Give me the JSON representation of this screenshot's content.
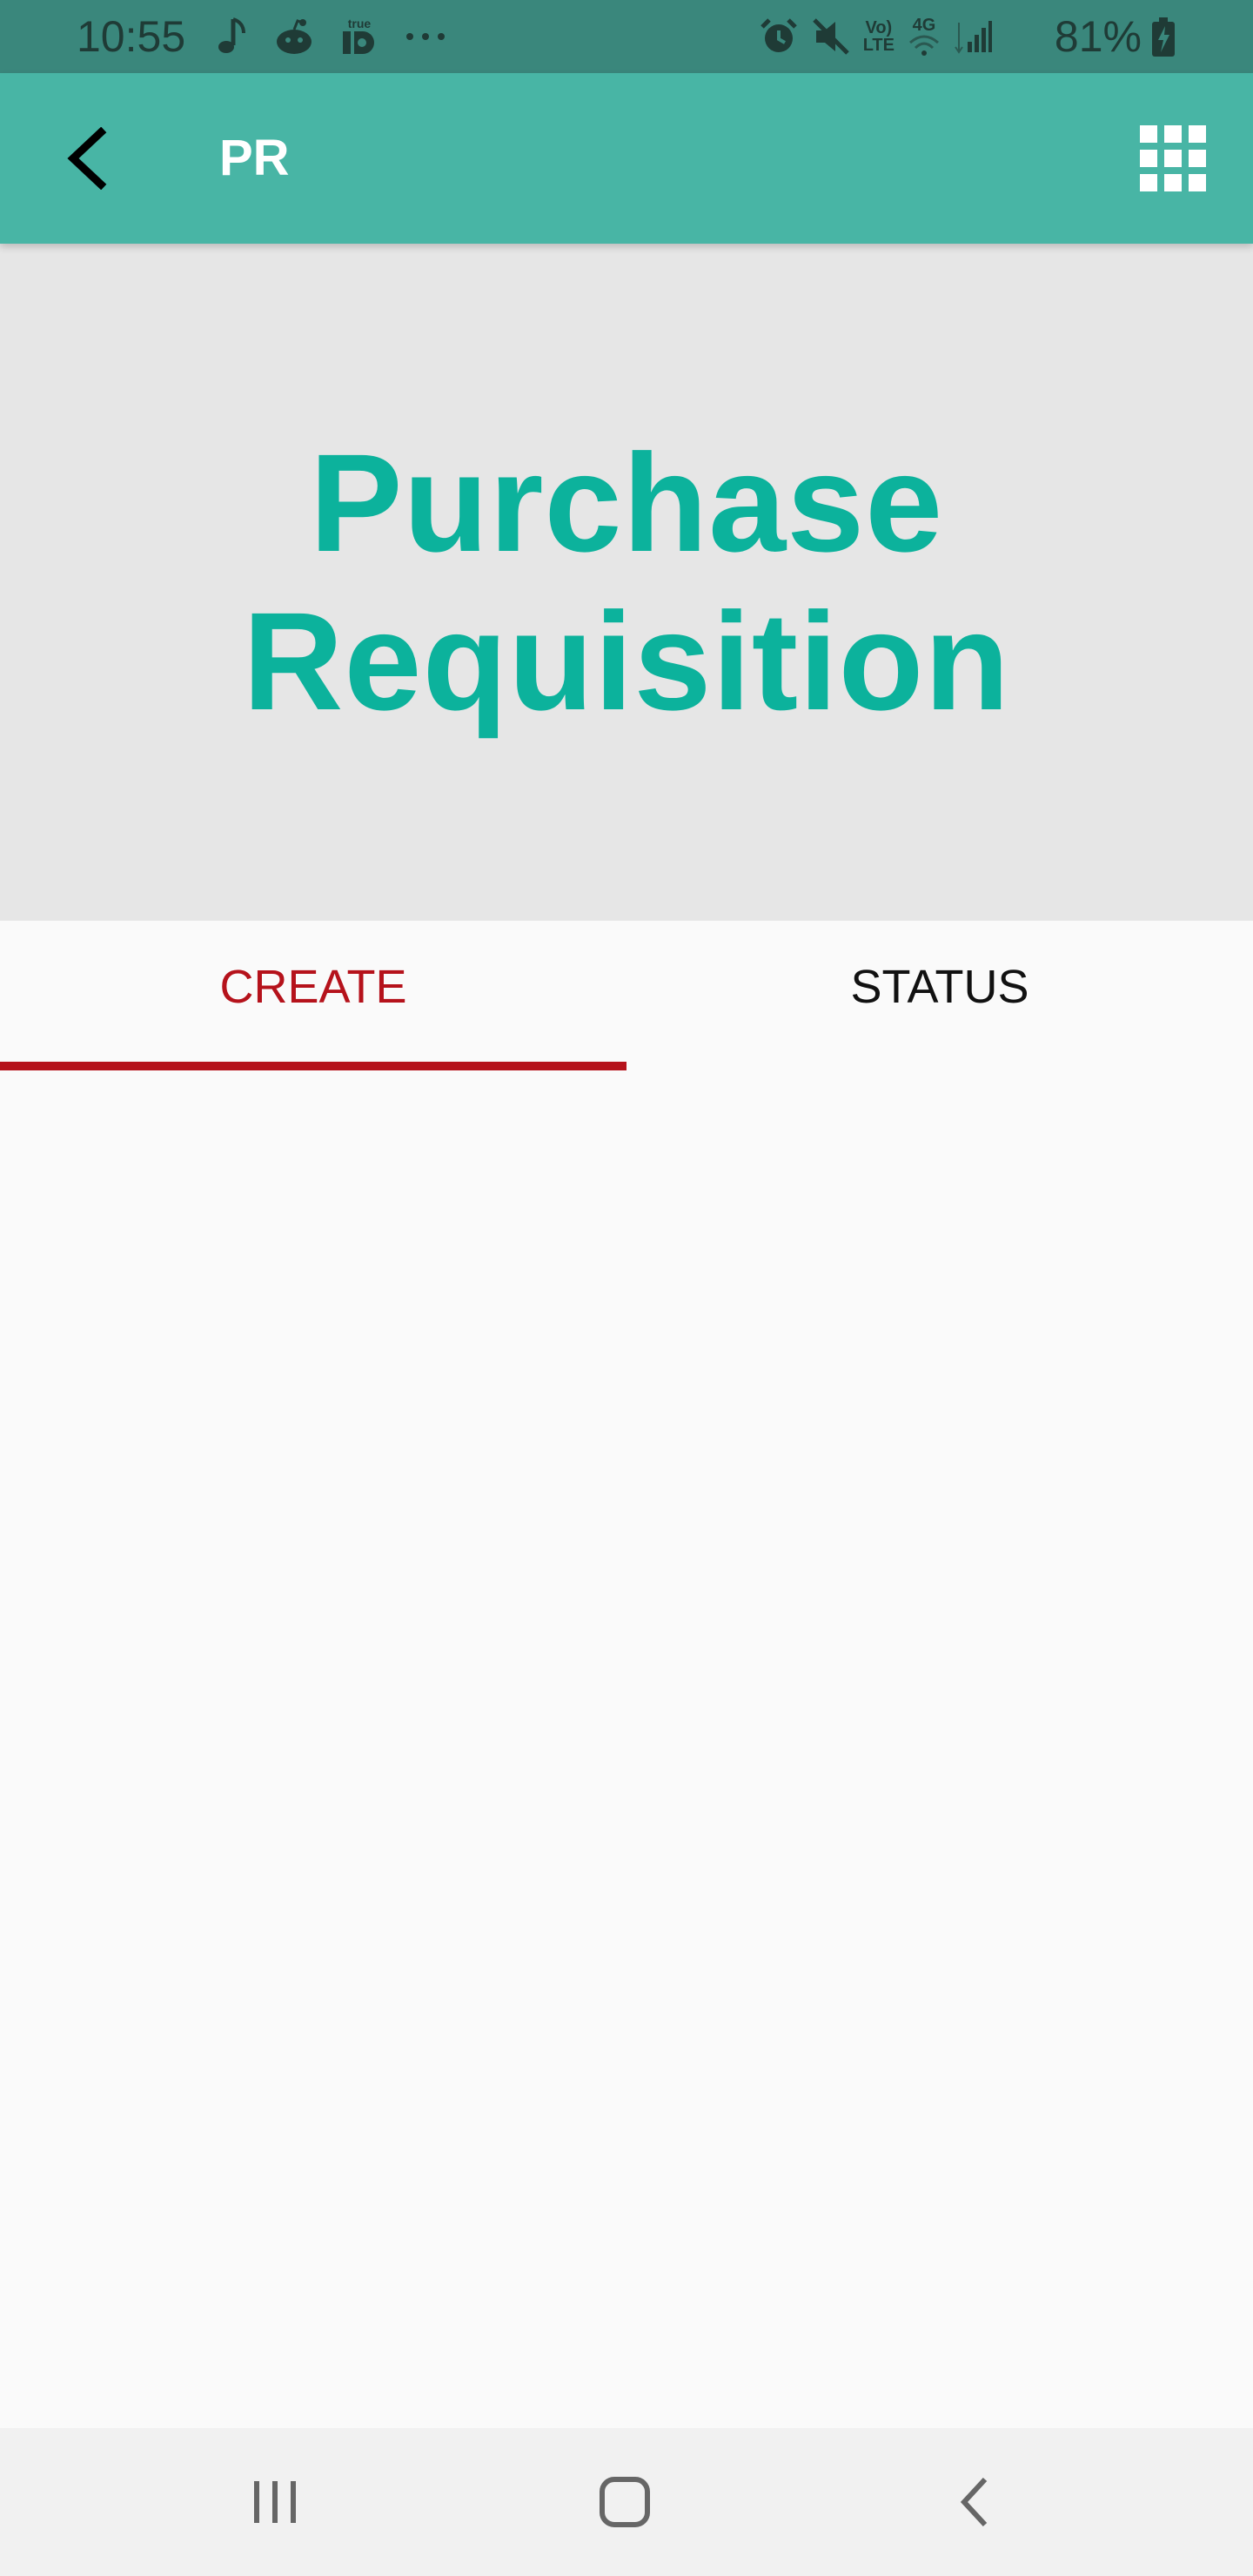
{
  "status_bar": {
    "time": "10:55",
    "network_top": "Vo)",
    "network_bottom": "LTE",
    "network_gen": "4G",
    "battery_percent": "81%",
    "left_icons": [
      "music-note-icon",
      "reddit-icon",
      "trueid-icon",
      "more-dots-icon"
    ],
    "right_icons": [
      "alarm-icon",
      "mute-icon",
      "volte-icon",
      "wifi-icon",
      "signal-icon",
      "battery-charging-icon"
    ]
  },
  "app_bar": {
    "title": "PR",
    "back_icon": "back-arrow-icon",
    "menu_icon": "apps-grid-icon"
  },
  "hero": {
    "title_line1": "Purchase",
    "title_line2": "Requisition"
  },
  "tabs": [
    {
      "label": "CREATE",
      "active": true
    },
    {
      "label": "STATUS",
      "active": false
    }
  ],
  "colors": {
    "status_bar": "#3a877c",
    "app_bar": "#48b5a5",
    "hero_background": "#e6e6e6",
    "hero_text": "#0cb29c",
    "active_tab": "#b5121b",
    "nav_bar": "#f1f1f1"
  },
  "nav_bar": {
    "buttons": [
      "recent-apps-icon",
      "home-icon",
      "back-icon"
    ]
  }
}
